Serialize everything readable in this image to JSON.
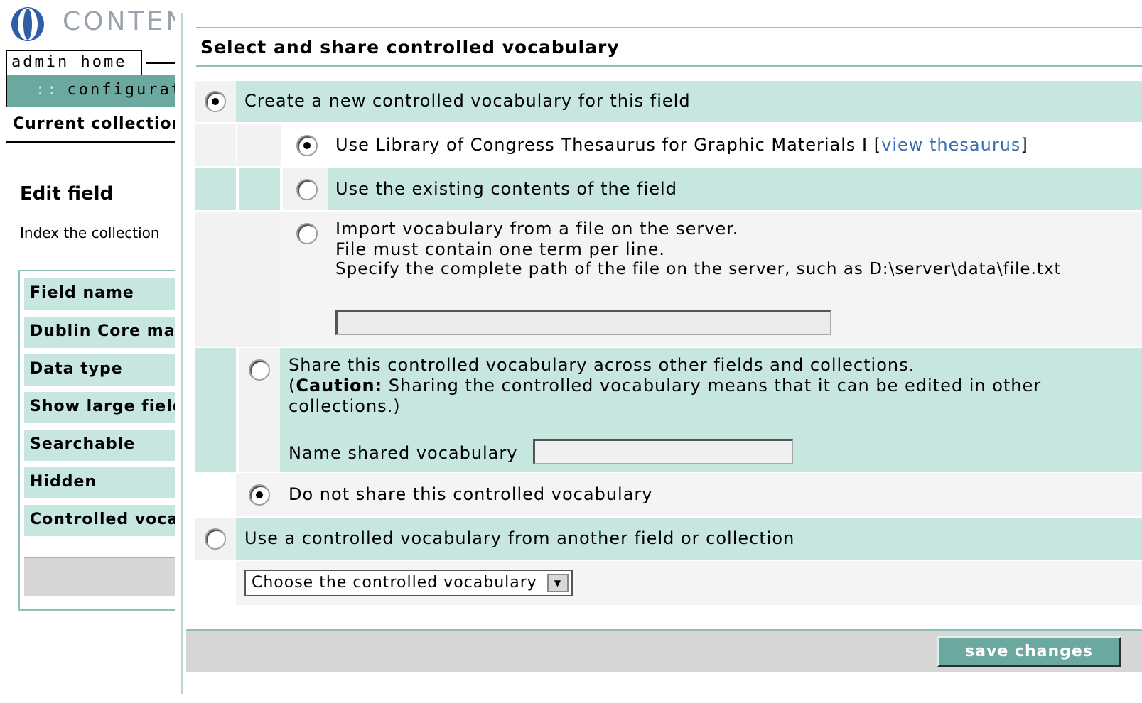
{
  "app": {
    "title": "CONTEN"
  },
  "nav": {
    "admin_home": "admin home",
    "config_dots": "::",
    "config_tab": "configurati"
  },
  "sidebar": {
    "current_collection": "Current collection",
    "edit_field": "Edit field",
    "index_text": "Index the collection",
    "items": [
      "Field name",
      "Dublin Core map",
      "Data type",
      "Show large field",
      "Searchable",
      "Hidden",
      "Controlled voca"
    ]
  },
  "main": {
    "section_title": "Select and share controlled vocabulary",
    "opt_create_new": "Create a new controlled vocabulary for this field",
    "opt_loc_prefix": "Use Library of Congress Thesaurus for Graphic Materials I [",
    "opt_loc_link": "view thesaurus",
    "opt_loc_suffix": "]",
    "opt_existing": "Use the existing contents of the field",
    "opt_import_line1": "Import vocabulary from a file on the server.",
    "opt_import_line2": "File must contain one term per line.",
    "opt_import_line3": "Specify the complete path of the file on the server, such as D:\\server\\data\\file.txt",
    "import_path_value": "",
    "opt_share_line1": "Share this controlled vocabulary across other fields and collections.",
    "opt_share_caution_label": "Caution:",
    "opt_share_line2_open": "(",
    "opt_share_line2_rest": " Sharing the controlled vocabulary means that it can be edited in other",
    "opt_share_line3": "collections.)",
    "name_shared_label": "Name shared vocabulary",
    "name_shared_value": "",
    "opt_no_share": "Do not share this controlled vocabulary",
    "opt_other_field": "Use a controlled vocabulary from another field or collection",
    "select_value": "Choose the controlled vocabulary",
    "save_button": "save changes"
  },
  "radios": {
    "create_new": true,
    "use_loc": true,
    "use_existing": false,
    "import_file": false,
    "share": false,
    "no_share": true,
    "other_field": false
  },
  "colors": {
    "teal_light": "#c7e6df",
    "teal_dark": "#6aa8a0",
    "link": "#3a6fb0",
    "gray_bar": "#d6d6d6"
  }
}
